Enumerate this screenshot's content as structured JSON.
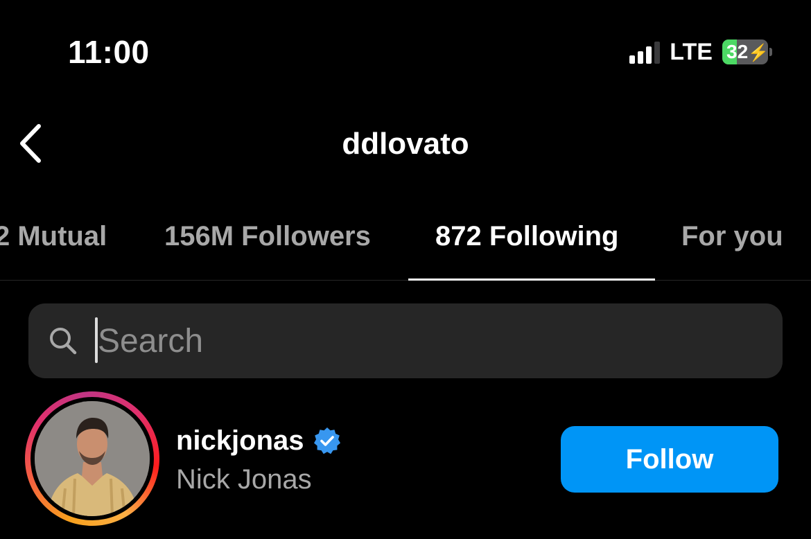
{
  "status_bar": {
    "time": "11:00",
    "network": "LTE",
    "battery_level": "32",
    "battery_fraction": 0.32,
    "battery_charging_glyph": "⚡",
    "signal_bars_active": 3,
    "signal_bars_total": 4
  },
  "header": {
    "back_icon": "chevron-left-icon",
    "title": "ddlovato"
  },
  "tabs": [
    {
      "label": "2 Mutual",
      "active": false
    },
    {
      "label": "156M Followers",
      "active": false
    },
    {
      "label": "872 Following",
      "active": true
    },
    {
      "label": "For you",
      "active": false
    }
  ],
  "search": {
    "icon": "search-icon",
    "placeholder": "Search",
    "value": ""
  },
  "users": [
    {
      "username": "nickjonas",
      "full_name": "Nick Jonas",
      "verified": true,
      "has_story_ring": true,
      "follow_label": "Follow"
    }
  ],
  "colors": {
    "background": "#000000",
    "accent": "#0095f6",
    "verified_badge": "#3897f0",
    "secondary_text": "#a8a8a8",
    "search_bg": "#262626",
    "battery_green": "#4cd964"
  }
}
